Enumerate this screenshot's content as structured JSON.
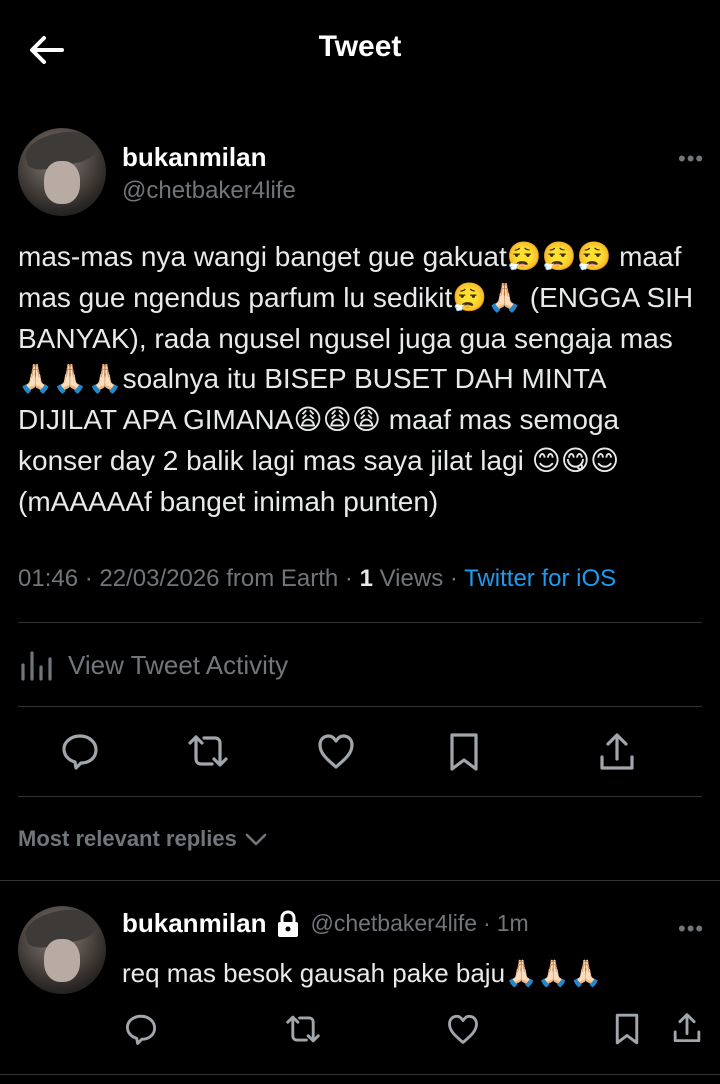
{
  "header": {
    "title": "Tweet"
  },
  "tweet": {
    "name": "bukanmilan",
    "handle": "@chetbaker4life",
    "text": "mas-mas nya wangi banget gue gakuat😮‍💨😮‍💨😮‍💨 maaf mas gue ngendus parfum lu sedikit😮‍💨🙏🏻 (ENGGA SIH BANYAK), rada ngusel ngusel juga gua sengaja mas🙏🏻🙏🏻🙏🏻soalnya itu BISEP BUSET DAH MINTA DIJILAT APA GIMANA😩😩😩 maaf mas semoga konser day 2 balik lagi mas saya jilat lagi 😊😋😊(mAAAAAf banget inimah punten)",
    "time": "01:46",
    "date": "22/03/2026",
    "location": "from Earth",
    "views_count": "1",
    "views_label": "Views",
    "source": "Twitter for iOS",
    "more": "•••"
  },
  "activity": {
    "label": "View Tweet Activity"
  },
  "replies": {
    "sort_label": "Most relevant replies"
  },
  "reply": {
    "name": "bukanmilan",
    "handle": "@chetbaker4life",
    "age": "1m",
    "text": "req mas besok gausah pake baju🙏🏻🙏🏻🙏🏻",
    "more": "•••"
  },
  "colors": {
    "background": "#000000",
    "text": "#e7e9ea",
    "muted": "#71767b",
    "link": "#1d9bf0",
    "divider": "#2f3336"
  },
  "icons": [
    "back-arrow-icon",
    "more-icon",
    "bar-chart-icon",
    "reply-icon",
    "retweet-icon",
    "like-icon",
    "bookmark-icon",
    "share-icon",
    "chevron-down-icon",
    "lock-icon"
  ]
}
